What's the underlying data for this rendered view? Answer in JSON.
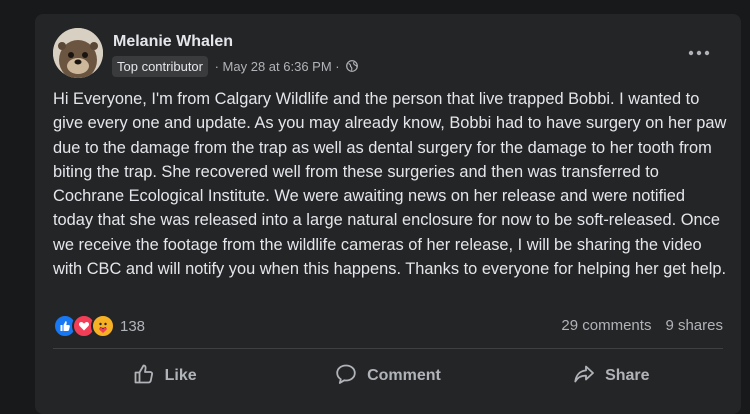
{
  "post": {
    "author": "Melanie Whalen",
    "badge": "Top contributor",
    "meta": " · May 28 at 6:36 PM · ",
    "text": "Hi Everyone,  I'm from Calgary Wildlife and the person that live trapped Bobbi.  I wanted to give every one and update.  As you may already know, Bobbi had to have surgery on her paw due to the damage from the trap as well as dental surgery for the damage to her tooth from biting the trap.  She recovered well from these surgeries and then was transferred to Cochrane Ecological Institute.  We were awaiting news on her release and were notified today that she was released into a large natural enclosure for now to be soft-released. Once we receive the footage from the wildlife cameras of her release, I will be sharing the video with CBC and will notify you when this happens.  Thanks to everyone for helping her get help."
  },
  "stats": {
    "reaction_count": "138",
    "comments": "29 comments",
    "shares": "9 shares"
  },
  "actions": {
    "like": "Like",
    "comment": "Comment",
    "share": "Share"
  },
  "colors": {
    "background": "#18191a",
    "card": "#242526",
    "primary_text": "#e4e6eb",
    "secondary_text": "#b0b3b8",
    "like_blue": "#1877f2",
    "love_red": "#f33e58",
    "care_yellow": "#f7b125"
  },
  "icons": [
    "otter-avatar",
    "globe-icon",
    "more-options-icon",
    "like-reaction-icon",
    "love-reaction-icon",
    "care-reaction-icon",
    "thumbs-up-icon",
    "comment-icon",
    "share-icon"
  ]
}
